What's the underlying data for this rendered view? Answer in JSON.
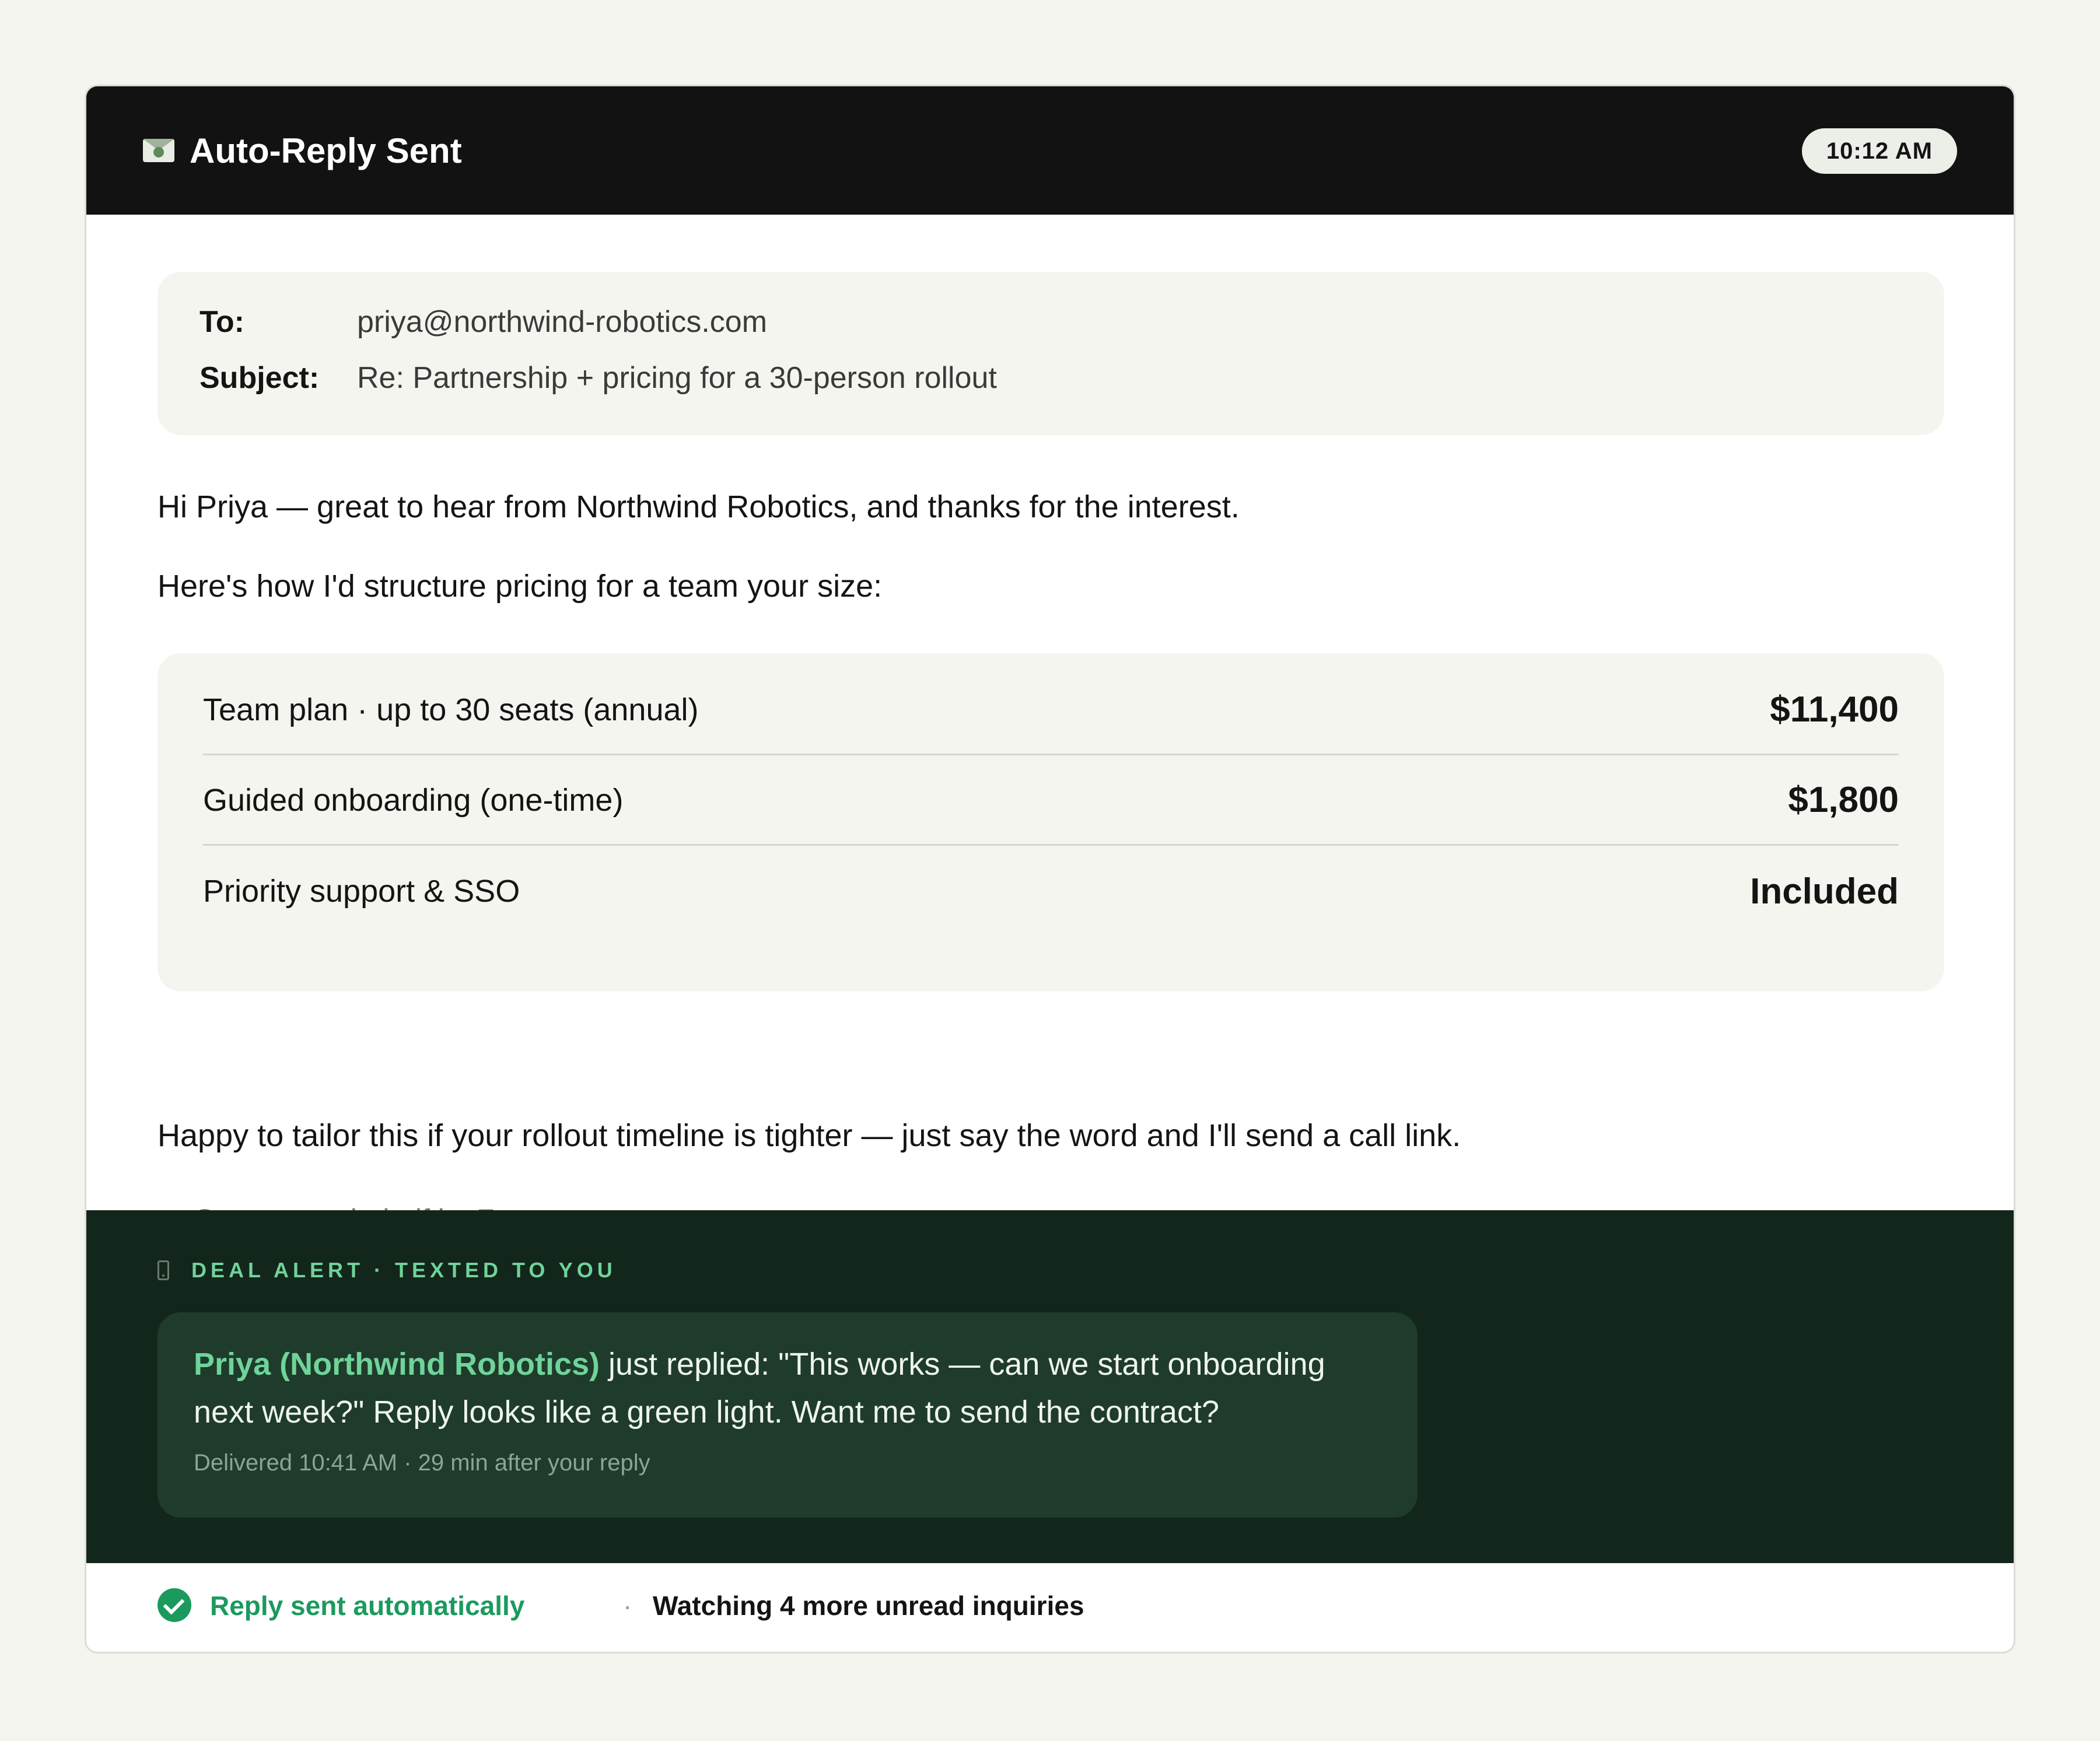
{
  "header": {
    "title": "Auto-Reply Sent",
    "time": "10:12 AM",
    "icon": "envelope-icon"
  },
  "email": {
    "to_label": "To:",
    "to_value": "priya@northwind-robotics.com",
    "subject_label": "Subject:",
    "subject_value": "Re: Partnership + pricing for a 30-person rollout",
    "greeting": "Hi Priya — great to hear from Northwind Robotics, and thanks for the interest.",
    "intro": "Here's how I'd structure pricing for a team your size:",
    "pricing": [
      {
        "label": "Team plan · up to 30 seats (annual)",
        "value": "$11,400"
      },
      {
        "label": "Guided onboarding (one-time)",
        "value": "$1,800"
      },
      {
        "label": "Priority support & SSO",
        "value": "Included"
      }
    ],
    "closing": "Happy to tailor this if your rollout timeline is tighter — just say the word and I'll send a call link.",
    "signature": "— Sent on my behalf by Zentor"
  },
  "alert": {
    "tag": "DEAL ALERT · TEXTED TO YOU",
    "icon": "phone-icon",
    "sender": "Priya (Northwind Robotics)",
    "message": " just replied: \"This works — can we start onboarding next week?\" Reply looks like a green light. Want me to send the contract?",
    "delivered": "Delivered 10:41 AM · 29 min after your reply"
  },
  "footer": {
    "status": "Reply sent automatically",
    "separator": "·",
    "watching": "Watching 4 more unread inquiries",
    "icon": "check-circle-icon"
  },
  "colors": {
    "accent_green": "#1c9a5e",
    "alert_green": "#6fd39a",
    "header_bg": "#121212",
    "alert_bg": "#13261b"
  }
}
